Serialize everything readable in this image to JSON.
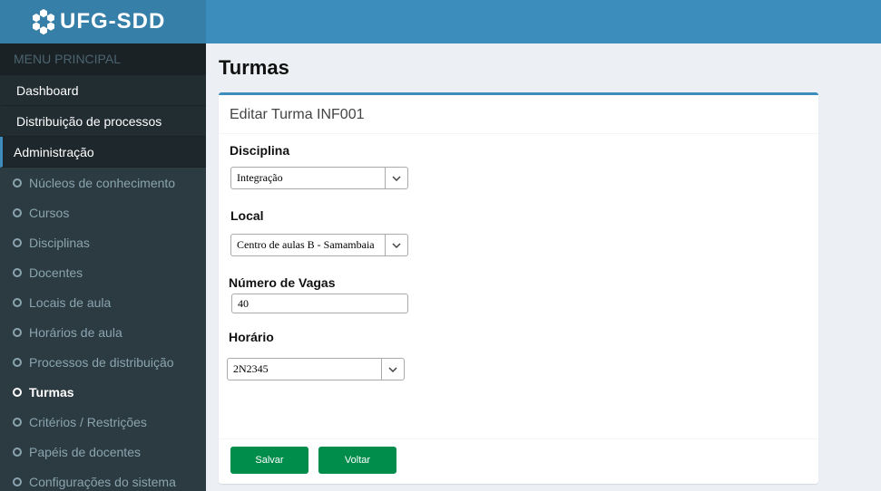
{
  "app": {
    "logo_text": "UFG-SDD"
  },
  "sidebar": {
    "header": "MENU PRINCIPAL",
    "items": [
      {
        "label": "Dashboard"
      },
      {
        "label": "Distribuição de processos"
      },
      {
        "label": "Administração"
      }
    ],
    "submenu": [
      {
        "label": "Núcleos de conhecimento"
      },
      {
        "label": "Cursos"
      },
      {
        "label": "Disciplinas"
      },
      {
        "label": "Docentes"
      },
      {
        "label": "Locais de aula"
      },
      {
        "label": "Horários de aula"
      },
      {
        "label": "Processos de distribuição"
      },
      {
        "label": "Turmas"
      },
      {
        "label": "Critérios / Restrições"
      },
      {
        "label": "Papéis de docentes"
      },
      {
        "label": "Configurações do sistema"
      }
    ]
  },
  "page": {
    "title": "Turmas"
  },
  "form": {
    "title": "Editar Turma INF001",
    "disciplina": {
      "label": "Disciplina",
      "value": "Integração"
    },
    "local": {
      "label": "Local",
      "value": "Centro de aulas B - Samambaia"
    },
    "vagas": {
      "label": "Número de Vagas",
      "value": "40"
    },
    "horario": {
      "label": "Horário",
      "value": "2N2345"
    },
    "save_label": "Salvar",
    "back_label": "Voltar"
  },
  "colors": {
    "brand": "#3c8dbc",
    "sidebar": "#222d32",
    "button": "#008d4c"
  }
}
